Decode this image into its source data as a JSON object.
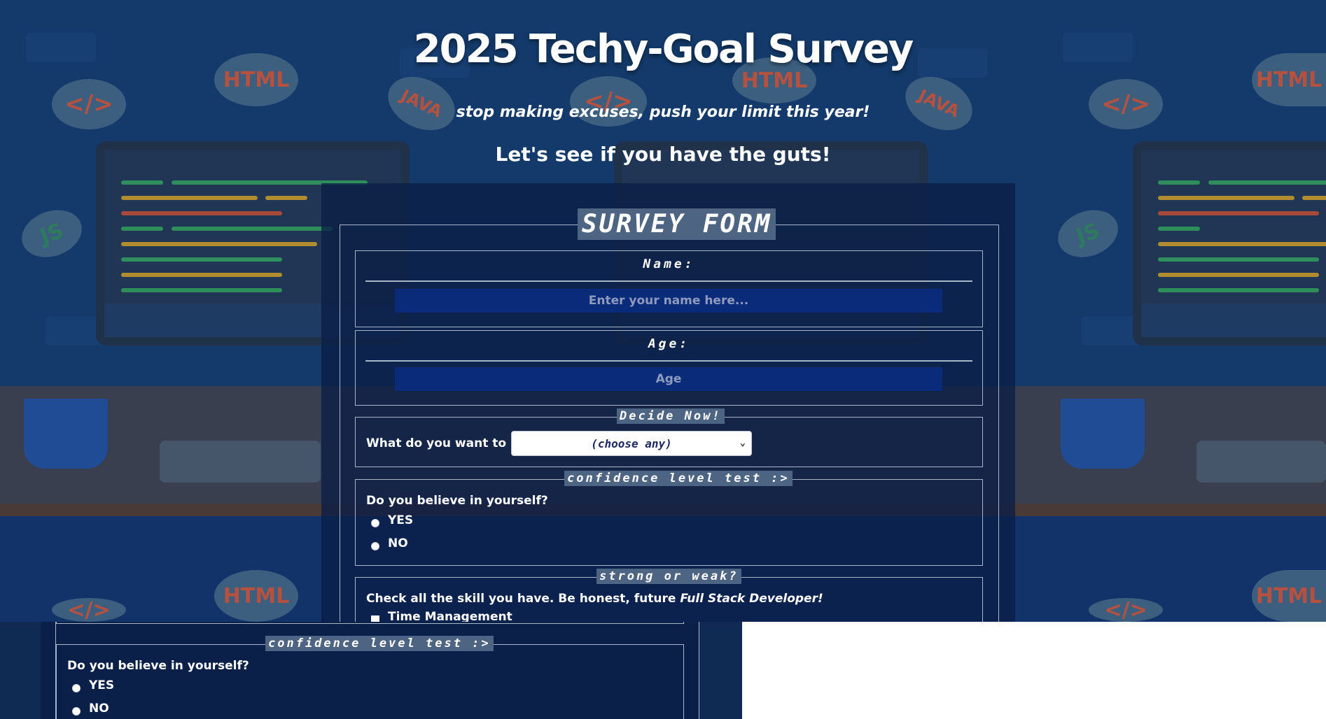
{
  "header": {
    "title": "2025 Techy-Goal Survey",
    "subtitle": "stop making excuses, push your limit this year!",
    "tagline": "Let's see if you have the guts!"
  },
  "background": {
    "bubbles": [
      "</>",
      "HTML",
      "JAVA",
      "</>",
      "HTML",
      "JAVA",
      "</>",
      "HTML",
      "JS",
      "JS",
      "HTML",
      "</>",
      "HTML",
      "</>"
    ]
  },
  "form": {
    "legend": "SURVEY FORM",
    "name": {
      "label": "Name:",
      "placeholder": "Enter your name here..."
    },
    "age": {
      "label": "Age:",
      "placeholder": "Age"
    },
    "decide": {
      "legend": "Decide Now!",
      "question": "What do you want to be?",
      "selected": "(choose any)"
    },
    "confidence": {
      "legend": "confidence level test :>",
      "question": "Do you believe in yourself?",
      "options": [
        "YES",
        "NO"
      ]
    },
    "skills": {
      "legend": "strong or weak?",
      "question_prefix": "Check all the skill you have. Be honest, future ",
      "question_emphasis": "Full Stack Developer!",
      "first_option": "Time Management"
    }
  },
  "colors": {
    "background": "#133a6a",
    "panel": "#0a1e46",
    "legend_bg": "#4e6483",
    "input_bg": "#0a2b7a",
    "border": "#a9b7c9"
  }
}
